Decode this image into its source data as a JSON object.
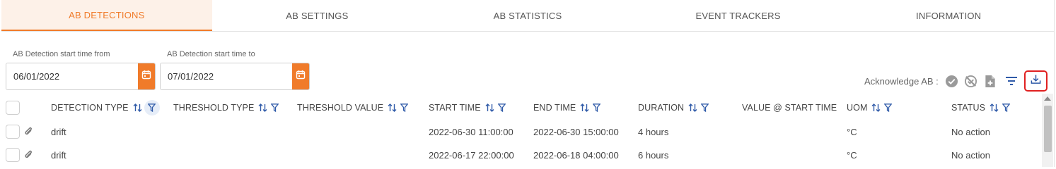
{
  "tabs": [
    {
      "label": "AB DETECTIONS",
      "active": true
    },
    {
      "label": "AB SETTINGS",
      "active": false
    },
    {
      "label": "AB STATISTICS",
      "active": false
    },
    {
      "label": "EVENT TRACKERS",
      "active": false
    },
    {
      "label": "INFORMATION",
      "active": false
    }
  ],
  "filters": {
    "start_from": {
      "label": "AB Detection start time from",
      "value": "06/01/2022"
    },
    "start_to": {
      "label": "AB Detection start time to",
      "value": "07/01/2022"
    }
  },
  "toolbar": {
    "acknowledge_label": "Acknowledge AB :",
    "icons": [
      "check-circle-icon",
      "cancel-circle-icon",
      "add-document-icon",
      "filter-lines-icon",
      "download-icon"
    ]
  },
  "table": {
    "columns": [
      "DETECTION TYPE",
      "THRESHOLD TYPE",
      "THRESHOLD VALUE",
      "START TIME",
      "END TIME",
      "DURATION",
      "VALUE @ START TIME",
      "UOM",
      "STATUS"
    ],
    "rows": [
      {
        "detection_type": "drift",
        "threshold_type": "",
        "threshold_value": "",
        "start_time": "2022-06-30 11:00:00",
        "end_time": "2022-06-30 15:00:00",
        "duration": "4 hours",
        "value_at_start": "",
        "uom": "°C",
        "status": "No action"
      },
      {
        "detection_type": "drift",
        "threshold_type": "",
        "threshold_value": "",
        "start_time": "2022-06-17 22:00:00",
        "end_time": "2022-06-18 04:00:00",
        "duration": "6 hours",
        "value_at_start": "",
        "uom": "°C",
        "status": "No action"
      }
    ]
  },
  "colors": {
    "accent": "#f07b2a",
    "active_tab_bg": "#fdf1e8",
    "icon_blue": "#2f5aa8",
    "highlight_red": "#e02020",
    "icon_gray": "#9a9a9a"
  }
}
